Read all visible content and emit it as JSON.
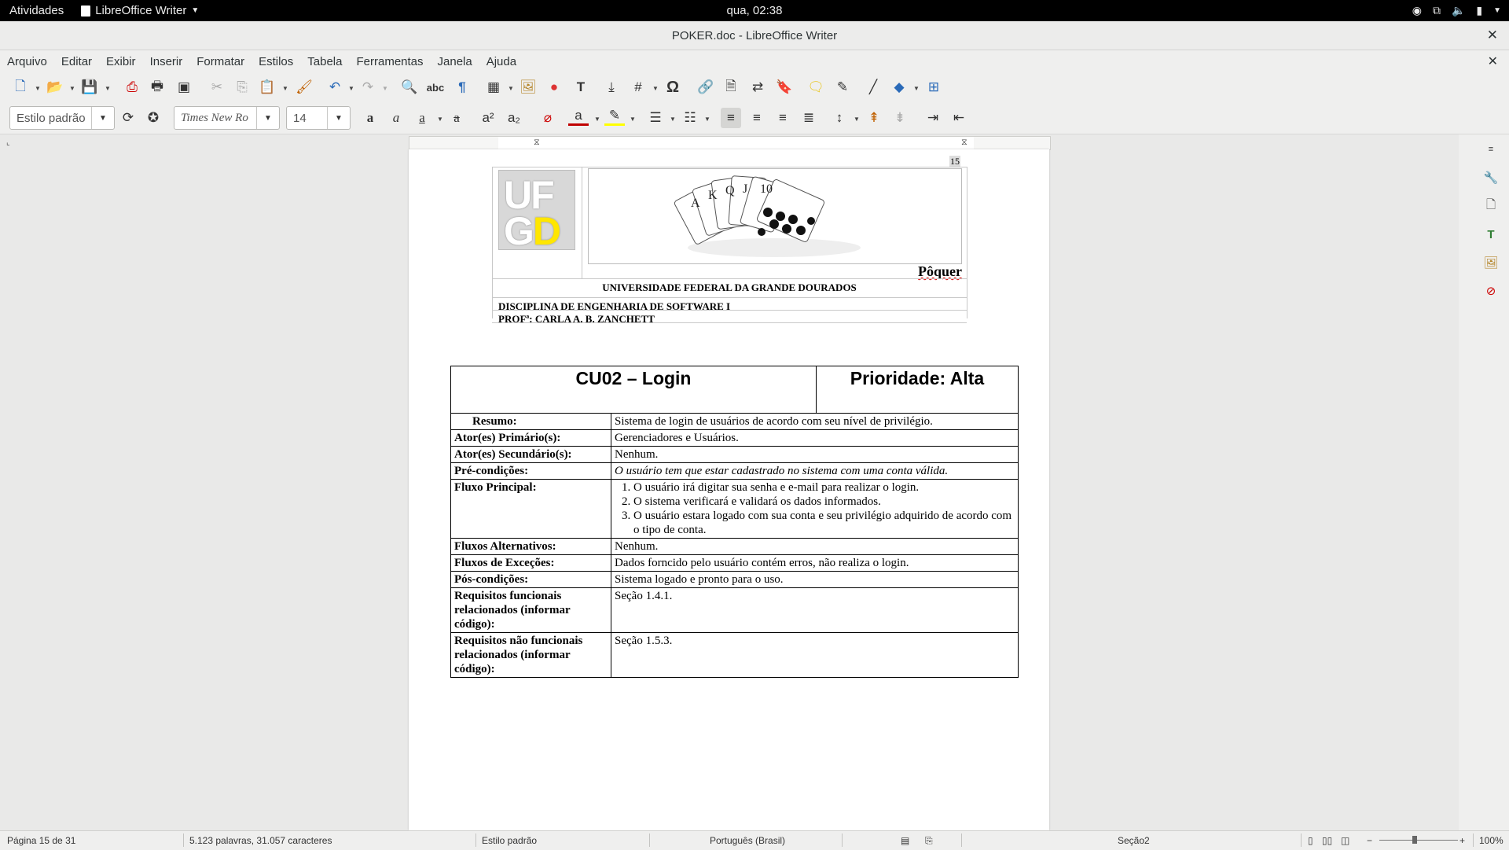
{
  "topbar": {
    "activities": "Atividades",
    "app_name": "LibreOffice Writer",
    "clock": "qua, 02:38"
  },
  "window": {
    "title": "POKER.doc - LibreOffice Writer"
  },
  "menu": [
    "Arquivo",
    "Editar",
    "Exibir",
    "Inserir",
    "Formatar",
    "Estilos",
    "Tabela",
    "Ferramentas",
    "Janela",
    "Ajuda"
  ],
  "formatting": {
    "paragraph_style": "Estilo padrão",
    "font_name": "Times New Ro",
    "font_size": "14"
  },
  "page_number_marker": "15",
  "header": {
    "logo_top": "UF",
    "logo_bottom_1": "G",
    "logo_bottom_2": "D",
    "game_title": "Pôquer",
    "university": "UNIVERSIDADE FEDERAL DA GRANDE DOURADOS",
    "discipline": "DISCIPLINA DE ENGENHARIA DE SOFTWARE I",
    "professor": "PROFª: CARLA A. B. ZANCHETT"
  },
  "use_case": {
    "title": "CU02 – Login",
    "priority": "Prioridade: Alta",
    "rows": [
      {
        "label": "Resumo:",
        "value": "Sistema de login de usuários de acordo com seu nível de privilégio."
      },
      {
        "label": "Ator(es) Primário(s):",
        "value": "Gerenciadores e Usuários."
      },
      {
        "label": "Ator(es) Secundário(s):",
        "value": "Nenhum."
      },
      {
        "label": "Pré-condições:",
        "value": "O usuário tem que estar cadastrado no sistema com uma conta válida."
      },
      {
        "label": "Fluxo Principal:",
        "steps": [
          "O usuário irá digitar sua senha e e-mail para realizar o login.",
          "O sistema verificará e validará os dados informados.",
          "O usuário estara logado com sua conta e seu privilégio adquirido de acordo com o tipo de conta."
        ]
      },
      {
        "label": "Fluxos Alternativos:",
        "value": "Nenhum."
      },
      {
        "label": "Fluxos de Exceções:",
        "value": "Dados forncido pelo usuário contém erros, não realiza o login."
      },
      {
        "label": "Pós-condições:",
        "value": "Sistema logado e pronto para o uso."
      },
      {
        "label": "Requisitos funcionais relacionados (informar código):",
        "value": "Seção 1.4.1."
      },
      {
        "label": "Requisitos não funcionais relacionados (informar código):",
        "value": "Seção 1.5.3."
      }
    ]
  },
  "status": {
    "page": "Página 15 de 31",
    "words": "5.123 palavras, 31.057 caracteres",
    "style": "Estilo padrão",
    "language": "Português (Brasil)",
    "section": "Seção2",
    "zoom": "100%"
  },
  "colors": {
    "logo_accent": "#ffe600",
    "font_color_underline": "#c00000",
    "highlight_underline": "#ffff00"
  }
}
